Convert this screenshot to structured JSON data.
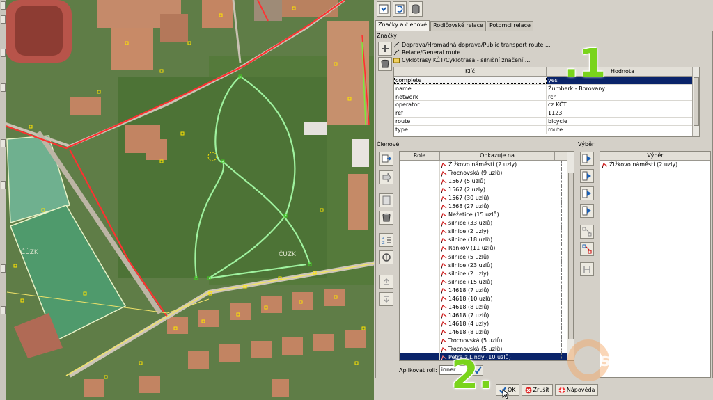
{
  "toolbar": {
    "icons": [
      "download-members-icon",
      "sort-refresh-icon",
      "database-icon"
    ]
  },
  "tabs": [
    {
      "label": "Značky a členové",
      "active": true
    },
    {
      "label": "Rodičovské relace",
      "active": false
    },
    {
      "label": "Potomci relace",
      "active": false
    }
  ],
  "tags": {
    "group_label": "Značky",
    "relations": [
      {
        "label": "Doprava/Hromadná doprava/Public transport route ..."
      },
      {
        "label": "Relace/General route ..."
      },
      {
        "label": "Cyklotrasy KČT/Cyklotrasa - silniční značení ..."
      }
    ],
    "columns": {
      "key": "Klíč",
      "value": "Hodnota"
    },
    "rows": [
      {
        "key": "complete",
        "value": "yes"
      },
      {
        "key": "name",
        "value": "Žumberk - Borovany"
      },
      {
        "key": "network",
        "value": "rcn"
      },
      {
        "key": "operator",
        "value": "cz:KČT"
      },
      {
        "key": "ref",
        "value": "1123"
      },
      {
        "key": "route",
        "value": "bicycle"
      },
      {
        "key": "type",
        "value": "route"
      }
    ]
  },
  "members": {
    "group_label": "Členové",
    "columns": {
      "role": "Role",
      "refers": "Odkazuje na"
    },
    "rows": [
      {
        "role": "",
        "label": "Žižkovo náměstí (2 uzly)"
      },
      {
        "role": "",
        "label": "Trocnovská (9 uzlů)"
      },
      {
        "role": "",
        "label": "1567 (5 uzlů)"
      },
      {
        "role": "",
        "label": "1567 (2 uzly)"
      },
      {
        "role": "",
        "label": "1567 (30 uzlů)"
      },
      {
        "role": "",
        "label": "1568 (27 uzlů)"
      },
      {
        "role": "",
        "label": "Nežetice (15 uzlů)"
      },
      {
        "role": "",
        "label": "silnice (33 uzlů)"
      },
      {
        "role": "",
        "label": "silnice (2 uzly)"
      },
      {
        "role": "",
        "label": "silnice (18 uzlů)"
      },
      {
        "role": "",
        "label": "Rankov (11 uzlů)"
      },
      {
        "role": "",
        "label": "silnice (5 uzlů)"
      },
      {
        "role": "",
        "label": "silnice (23 uzlů)"
      },
      {
        "role": "",
        "label": "silnice (2 uzly)"
      },
      {
        "role": "",
        "label": "silnice (15 uzlů)"
      },
      {
        "role": "",
        "label": "14618 (7 uzlů)"
      },
      {
        "role": "",
        "label": "14618 (10 uzlů)"
      },
      {
        "role": "",
        "label": "14618 (8 uzlů)"
      },
      {
        "role": "",
        "label": "14618 (7 uzlů)"
      },
      {
        "role": "",
        "label": "14618 (4 uzly)"
      },
      {
        "role": "",
        "label": "14618 (8 uzlů)"
      },
      {
        "role": "",
        "label": "Trocnovská (5 uzlů)"
      },
      {
        "role": "",
        "label": "Trocnovská (5 uzlů)"
      },
      {
        "role": "",
        "label": "Petra z Lindy (10 uzlů)",
        "selected": true
      }
    ],
    "apply_role_label": "Aplikovat roli:",
    "apply_role_value": "inner"
  },
  "selection": {
    "group_label": "Výběr",
    "column": "Výběr",
    "rows": [
      {
        "label": "Žižkovo náměstí (2 uzly)"
      }
    ]
  },
  "buttons": {
    "ok": "OK",
    "cancel": "Zrušit",
    "help": "Nápověda"
  },
  "annotations": {
    "step1": ".1",
    "step2": "2."
  },
  "watermark": "smAnd.cz"
}
